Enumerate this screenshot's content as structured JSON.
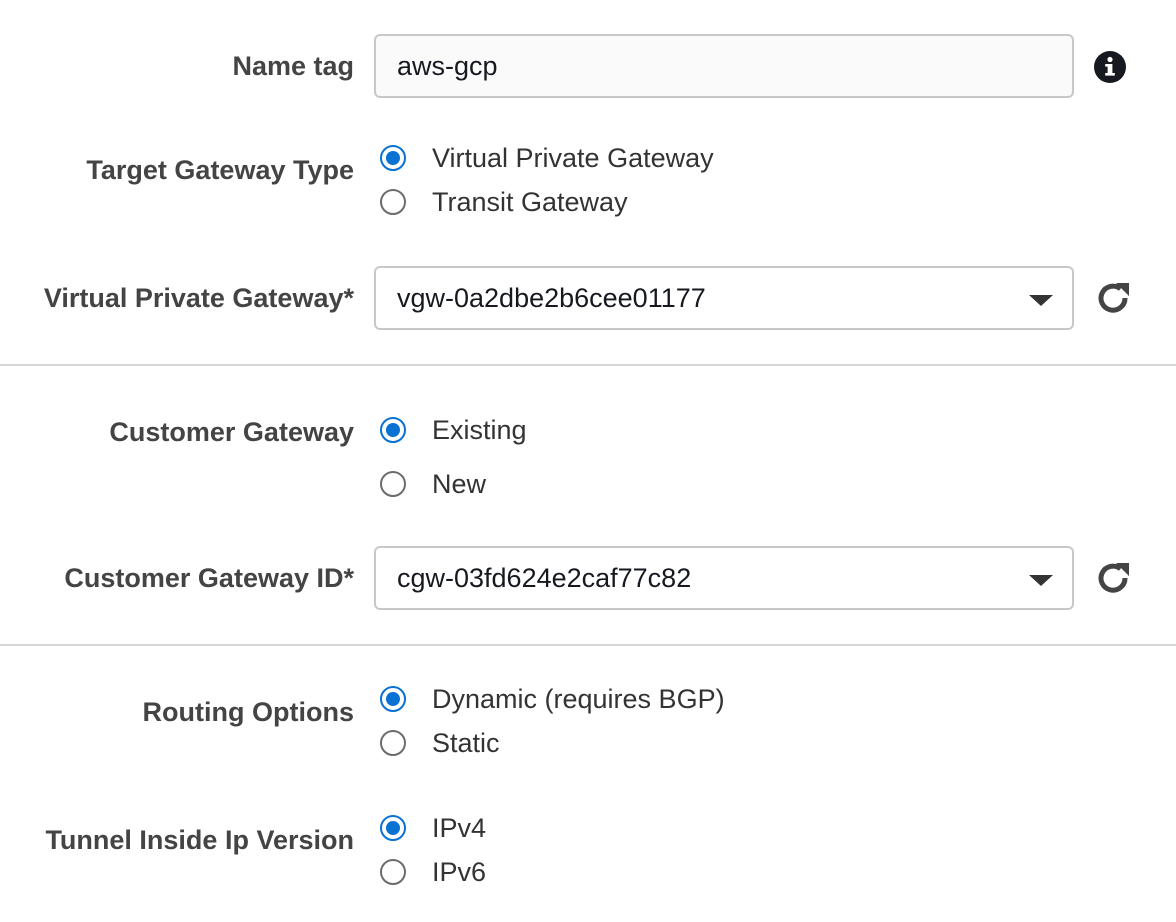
{
  "name_tag": {
    "label": "Name tag",
    "value": "aws-gcp",
    "info_icon": "info-icon"
  },
  "target_gateway_type": {
    "label": "Target Gateway Type",
    "options": [
      {
        "label": "Virtual Private Gateway",
        "checked": true
      },
      {
        "label": "Transit Gateway",
        "checked": false
      }
    ]
  },
  "virtual_private_gateway": {
    "label": "Virtual Private Gateway*",
    "value": "vgw-0a2dbe2b6cee01177",
    "refresh_icon": "refresh-icon"
  },
  "customer_gateway": {
    "label": "Customer Gateway",
    "options": [
      {
        "label": "Existing",
        "checked": true
      },
      {
        "label": "New",
        "checked": false
      }
    ]
  },
  "customer_gateway_id": {
    "label": "Customer Gateway ID*",
    "value": "cgw-03fd624e2caf77c82",
    "refresh_icon": "refresh-icon"
  },
  "routing_options": {
    "label": "Routing Options",
    "options": [
      {
        "label": "Dynamic (requires BGP)",
        "checked": true
      },
      {
        "label": "Static",
        "checked": false
      }
    ]
  },
  "tunnel_inside_ip_version": {
    "label": "Tunnel Inside Ip Version",
    "options": [
      {
        "label": "IPv4",
        "checked": true
      },
      {
        "label": "IPv6",
        "checked": false
      }
    ]
  },
  "colors": {
    "radio_selected": "#0972d3",
    "label_text": "#444444",
    "input_border": "#c8c8c8",
    "divider": "#d5d5d5"
  }
}
